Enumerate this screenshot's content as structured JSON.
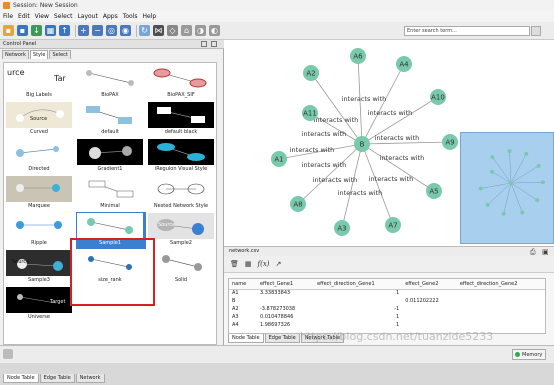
{
  "window": {
    "title": "Session: New Session"
  },
  "menu": [
    "File",
    "Edit",
    "View",
    "Select",
    "Layout",
    "Apps",
    "Tools",
    "Help"
  ],
  "search": {
    "placeholder": "Enter search term..."
  },
  "control_panel": {
    "title": "Control Panel",
    "tabs": [
      "Network",
      "Style",
      "Select"
    ],
    "active_tab": "Style",
    "styles": [
      "Big Labels",
      "BioPAX",
      "BioPAX_SIF",
      "Curved",
      "default",
      "default black",
      "Directed",
      "Gradient1",
      "iRegulon Visual Style",
      "Marquee",
      "Minimal",
      "Nested Network Style",
      "Ripple",
      "Sample1",
      "Sample2",
      "Sample3",
      "size_rank",
      "Solid",
      "Universe"
    ],
    "selected_style": "Sample1",
    "preview_text": {
      "source": "Source",
      "target": "Target",
      "big_left": "urce",
      "big_right": "Tar"
    },
    "bottom_tabs": [
      "Node Table",
      "Edge Table",
      "Network"
    ]
  },
  "network": {
    "center": "B",
    "edge_label": "interacts with",
    "nodes": [
      "A6",
      "A4",
      "A2",
      "A10",
      "A11",
      "A9",
      "A1",
      "A5",
      "A8",
      "A7",
      "A3"
    ],
    "node_color": "#79c9ac",
    "selection_color": "#a9cfee",
    "file_label": "network.csv"
  },
  "table": {
    "columns": [
      "name",
      "effect_Gene1",
      "effect_direction_Gene1",
      "effect_Gene2",
      "effect_direction_Gene2"
    ],
    "rows": [
      [
        "A1",
        "3.33833843",
        "1",
        "",
        ""
      ],
      [
        "B",
        "",
        "",
        "0.011202222",
        ""
      ],
      [
        "A2",
        "-3.878273038",
        "-1",
        "",
        ""
      ],
      [
        "A3",
        "0.010478846",
        "1",
        "",
        ""
      ],
      [
        "A4",
        "1.98697326",
        "1",
        "",
        ""
      ]
    ],
    "bottom_tabs": [
      "Node Table",
      "Edge Table",
      "Network Table"
    ]
  },
  "status": {
    "memory": "Memory"
  },
  "watermark": "https://blog.csdn.net/tuanzide5233"
}
